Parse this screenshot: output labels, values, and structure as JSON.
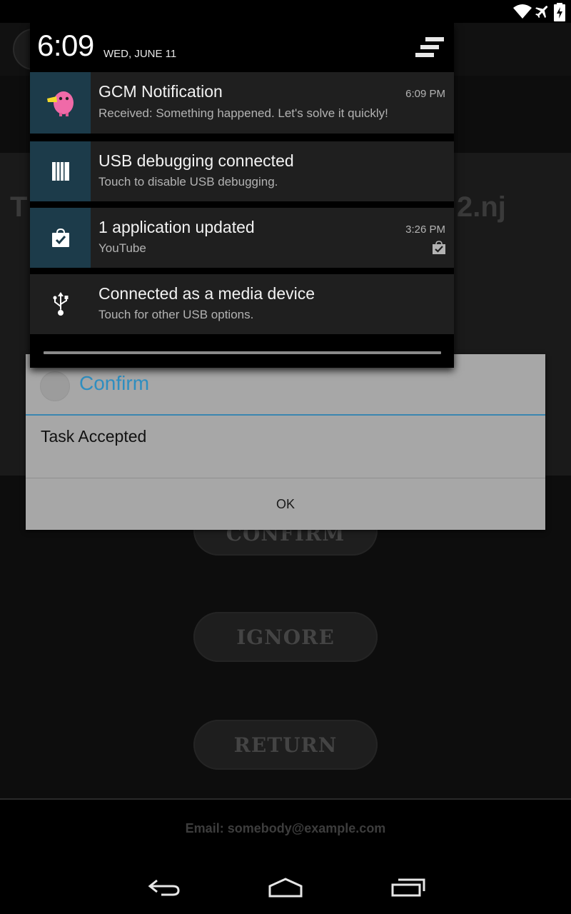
{
  "status_bar": {
    "icons": [
      "wifi-icon",
      "airplane-mode-icon",
      "battery-charging-icon"
    ]
  },
  "background_app": {
    "heading_start": "T",
    "heading_fragment": "2.nj",
    "buttons": {
      "confirm": "CONFIRM",
      "ignore": "IGNORE",
      "return": "RETURN"
    },
    "footer_email": "Email: somebody@example.com"
  },
  "dialog": {
    "title": "Confirm",
    "message": "Task Accepted",
    "ok_label": "OK",
    "accent_color": "#2f8ec0"
  },
  "notification_shade": {
    "time": "6:09",
    "date": "WED, JUNE 11",
    "clear_all_icon": "clear-all-icon",
    "notifications": [
      {
        "title": "GCM Notification",
        "text": "Received: Something happened. Let's solve it quickly!",
        "time": "6:09 PM",
        "icon": "pink-bird-app-icon",
        "icon_bg": "#1c3b4a"
      },
      {
        "title": "USB debugging connected",
        "text": "Touch to disable USB debugging.",
        "time": "",
        "icon": "usb-debugging-icon",
        "icon_bg": "#1c3b4a"
      },
      {
        "title": "1 application updated",
        "text": "YouTube",
        "time": "3:26 PM",
        "icon": "play-store-bag-icon",
        "icon_bg": "#1c3b4a"
      },
      {
        "title": "Connected as a media device",
        "text": "Touch for other USB options.",
        "time": "",
        "icon": "usb-icon",
        "icon_bg": "#1f1f1f"
      }
    ]
  },
  "nav_bar": {
    "icons": [
      "back-icon",
      "home-icon",
      "recent-apps-icon"
    ]
  }
}
